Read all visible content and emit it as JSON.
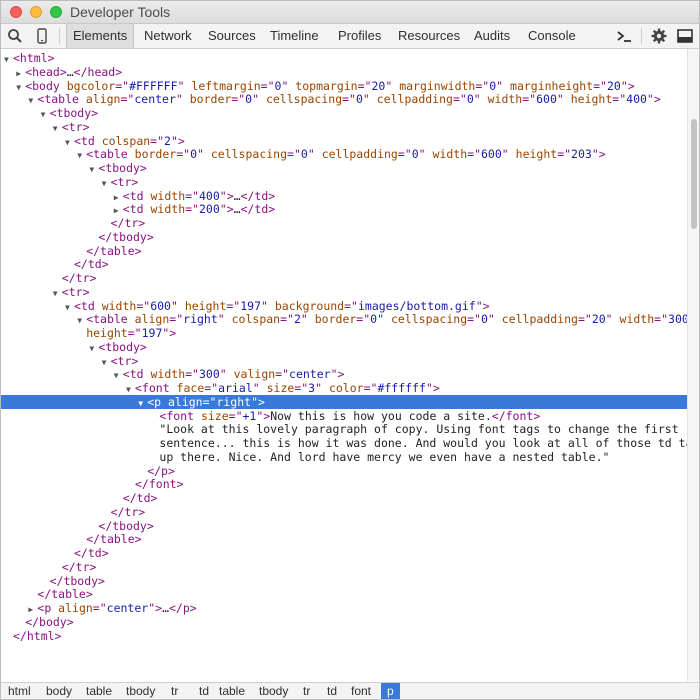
{
  "window": {
    "title": "Developer Tools"
  },
  "toolbar": {
    "left_icons": [
      "search-icon",
      "device-icon"
    ],
    "tabs": [
      {
        "label": "Elements",
        "active": true
      },
      {
        "label": "Network"
      },
      {
        "label": "Sources"
      },
      {
        "label": "Timeline"
      },
      {
        "label": "Profiles"
      },
      {
        "label": "Resources"
      },
      {
        "label": "Audits"
      },
      {
        "label": "Console"
      }
    ],
    "right_icons": [
      "console-drawer-icon",
      "gear-icon",
      "dock-icon"
    ]
  },
  "dom_tree": [
    {
      "indent": 0,
      "arrow": "down",
      "tokens": [
        [
          "tag",
          "<html>"
        ]
      ]
    },
    {
      "indent": 1,
      "arrow": "right",
      "tokens": [
        [
          "tag",
          "<head>"
        ],
        [
          "txt",
          "…"
        ],
        [
          "tag",
          "</head>"
        ]
      ]
    },
    {
      "indent": 1,
      "arrow": "down",
      "tokens": [
        [
          "tag",
          "<body "
        ],
        [
          "an",
          "bgcolor"
        ],
        [
          "tag",
          "=\""
        ],
        [
          "av",
          "#FFFFFF"
        ],
        [
          "tag",
          "\" "
        ],
        [
          "an",
          "leftmargin"
        ],
        [
          "tag",
          "=\""
        ],
        [
          "av",
          "0"
        ],
        [
          "tag",
          "\" "
        ],
        [
          "an",
          "topmargin"
        ],
        [
          "tag",
          "=\""
        ],
        [
          "av",
          "20"
        ],
        [
          "tag",
          "\" "
        ],
        [
          "an",
          "marginwidth"
        ],
        [
          "tag",
          "=\""
        ],
        [
          "av",
          "0"
        ],
        [
          "tag",
          "\" "
        ],
        [
          "an",
          "marginheight"
        ],
        [
          "tag",
          "=\""
        ],
        [
          "av",
          "20"
        ],
        [
          "tag",
          "\">"
        ]
      ]
    },
    {
      "indent": 2,
      "arrow": "down",
      "tokens": [
        [
          "tag",
          "<table "
        ],
        [
          "an",
          "align"
        ],
        [
          "tag",
          "=\""
        ],
        [
          "av",
          "center"
        ],
        [
          "tag",
          "\" "
        ],
        [
          "an",
          "border"
        ],
        [
          "tag",
          "=\""
        ],
        [
          "av",
          "0"
        ],
        [
          "tag",
          "\" "
        ],
        [
          "an",
          "cellspacing"
        ],
        [
          "tag",
          "=\""
        ],
        [
          "av",
          "0"
        ],
        [
          "tag",
          "\" "
        ],
        [
          "an",
          "cellpadding"
        ],
        [
          "tag",
          "=\""
        ],
        [
          "av",
          "0"
        ],
        [
          "tag",
          "\" "
        ],
        [
          "an",
          "width"
        ],
        [
          "tag",
          "=\""
        ],
        [
          "av",
          "600"
        ],
        [
          "tag",
          "\" "
        ],
        [
          "an",
          "height"
        ],
        [
          "tag",
          "=\""
        ],
        [
          "av",
          "400"
        ],
        [
          "tag",
          "\">"
        ]
      ]
    },
    {
      "indent": 3,
      "arrow": "down",
      "tokens": [
        [
          "tag",
          "<tbody>"
        ]
      ]
    },
    {
      "indent": 4,
      "arrow": "down",
      "tokens": [
        [
          "tag",
          "<tr>"
        ]
      ]
    },
    {
      "indent": 5,
      "arrow": "down",
      "tokens": [
        [
          "tag",
          "<td "
        ],
        [
          "an",
          "colspan"
        ],
        [
          "tag",
          "=\""
        ],
        [
          "av",
          "2"
        ],
        [
          "tag",
          "\">"
        ]
      ]
    },
    {
      "indent": 6,
      "arrow": "down",
      "tokens": [
        [
          "tag",
          "<table "
        ],
        [
          "an",
          "border"
        ],
        [
          "tag",
          "=\""
        ],
        [
          "av",
          "0"
        ],
        [
          "tag",
          "\" "
        ],
        [
          "an",
          "cellspacing"
        ],
        [
          "tag",
          "=\""
        ],
        [
          "av",
          "0"
        ],
        [
          "tag",
          "\" "
        ],
        [
          "an",
          "cellpadding"
        ],
        [
          "tag",
          "=\""
        ],
        [
          "av",
          "0"
        ],
        [
          "tag",
          "\" "
        ],
        [
          "an",
          "width"
        ],
        [
          "tag",
          "=\""
        ],
        [
          "av",
          "600"
        ],
        [
          "tag",
          "\" "
        ],
        [
          "an",
          "height"
        ],
        [
          "tag",
          "=\""
        ],
        [
          "av",
          "203"
        ],
        [
          "tag",
          "\">"
        ]
      ]
    },
    {
      "indent": 7,
      "arrow": "down",
      "tokens": [
        [
          "tag",
          "<tbody>"
        ]
      ]
    },
    {
      "indent": 8,
      "arrow": "down",
      "tokens": [
        [
          "tag",
          "<tr>"
        ]
      ]
    },
    {
      "indent": 9,
      "arrow": "right",
      "tokens": [
        [
          "tag",
          "<td "
        ],
        [
          "an",
          "width"
        ],
        [
          "tag",
          "=\""
        ],
        [
          "av",
          "400"
        ],
        [
          "tag",
          "\">"
        ],
        [
          "txt",
          "…"
        ],
        [
          "tag",
          "</td>"
        ]
      ]
    },
    {
      "indent": 9,
      "arrow": "right",
      "tokens": [
        [
          "tag",
          "<td "
        ],
        [
          "an",
          "width"
        ],
        [
          "tag",
          "=\""
        ],
        [
          "av",
          "200"
        ],
        [
          "tag",
          "\">"
        ],
        [
          "txt",
          "…"
        ],
        [
          "tag",
          "</td>"
        ]
      ]
    },
    {
      "indent": 8,
      "arrow": "",
      "tokens": [
        [
          "tag",
          "</tr>"
        ]
      ]
    },
    {
      "indent": 7,
      "arrow": "",
      "tokens": [
        [
          "tag",
          "</tbody>"
        ]
      ]
    },
    {
      "indent": 6,
      "arrow": "",
      "tokens": [
        [
          "tag",
          "</table>"
        ]
      ]
    },
    {
      "indent": 5,
      "arrow": "",
      "tokens": [
        [
          "tag",
          "</td>"
        ]
      ]
    },
    {
      "indent": 4,
      "arrow": "",
      "tokens": [
        [
          "tag",
          "</tr>"
        ]
      ]
    },
    {
      "indent": 4,
      "arrow": "down",
      "tokens": [
        [
          "tag",
          "<tr>"
        ]
      ]
    },
    {
      "indent": 5,
      "arrow": "down",
      "tokens": [
        [
          "tag",
          "<td "
        ],
        [
          "an",
          "width"
        ],
        [
          "tag",
          "=\""
        ],
        [
          "av",
          "600"
        ],
        [
          "tag",
          "\" "
        ],
        [
          "an",
          "height"
        ],
        [
          "tag",
          "=\""
        ],
        [
          "av",
          "197"
        ],
        [
          "tag",
          "\" "
        ],
        [
          "an",
          "background"
        ],
        [
          "tag",
          "=\""
        ],
        [
          "av",
          "images/bottom.gif"
        ],
        [
          "tag",
          "\">"
        ]
      ]
    },
    {
      "indent": 6,
      "arrow": "down",
      "tokens": [
        [
          "tag",
          "<table "
        ],
        [
          "an",
          "align"
        ],
        [
          "tag",
          "=\""
        ],
        [
          "av",
          "right"
        ],
        [
          "tag",
          "\" "
        ],
        [
          "an",
          "colspan"
        ],
        [
          "tag",
          "=\""
        ],
        [
          "av",
          "2"
        ],
        [
          "tag",
          "\" "
        ],
        [
          "an",
          "border"
        ],
        [
          "tag",
          "=\""
        ],
        [
          "av",
          "0"
        ],
        [
          "tag",
          "\" "
        ],
        [
          "an",
          "cellspacing"
        ],
        [
          "tag",
          "=\""
        ],
        [
          "av",
          "0"
        ],
        [
          "tag",
          "\" "
        ],
        [
          "an",
          "cellpadding"
        ],
        [
          "tag",
          "=\""
        ],
        [
          "av",
          "20"
        ],
        [
          "tag",
          "\" "
        ],
        [
          "an",
          "width"
        ],
        [
          "tag",
          "=\""
        ],
        [
          "av",
          "300"
        ],
        [
          "tag",
          "\""
        ]
      ]
    },
    {
      "indent": 6,
      "arrow": "",
      "tokens": [
        [
          "an",
          "height"
        ],
        [
          "tag",
          "=\""
        ],
        [
          "av",
          "197"
        ],
        [
          "tag",
          "\">"
        ]
      ]
    },
    {
      "indent": 7,
      "arrow": "down",
      "tokens": [
        [
          "tag",
          "<tbody>"
        ]
      ]
    },
    {
      "indent": 8,
      "arrow": "down",
      "tokens": [
        [
          "tag",
          "<tr>"
        ]
      ]
    },
    {
      "indent": 9,
      "arrow": "down",
      "tokens": [
        [
          "tag",
          "<td "
        ],
        [
          "an",
          "width"
        ],
        [
          "tag",
          "=\""
        ],
        [
          "av",
          "300"
        ],
        [
          "tag",
          "\" "
        ],
        [
          "an",
          "valign"
        ],
        [
          "tag",
          "=\""
        ],
        [
          "av",
          "center"
        ],
        [
          "tag",
          "\">"
        ]
      ]
    },
    {
      "indent": 10,
      "arrow": "down",
      "tokens": [
        [
          "tag",
          "<font "
        ],
        [
          "an",
          "face"
        ],
        [
          "tag",
          "=\""
        ],
        [
          "av",
          "arial"
        ],
        [
          "tag",
          "\" "
        ],
        [
          "an",
          "size"
        ],
        [
          "tag",
          "=\""
        ],
        [
          "av",
          "3"
        ],
        [
          "tag",
          "\" "
        ],
        [
          "an",
          "color"
        ],
        [
          "tag",
          "=\""
        ],
        [
          "av",
          "#ffffff"
        ],
        [
          "tag",
          "\">"
        ]
      ]
    },
    {
      "indent": 11,
      "arrow": "down",
      "selected": true,
      "tokens": [
        [
          "tag",
          "<p "
        ],
        [
          "an",
          "align"
        ],
        [
          "tag",
          "=\""
        ],
        [
          "av",
          "right"
        ],
        [
          "tag",
          "\">"
        ]
      ]
    },
    {
      "indent": 12,
      "arrow": "",
      "tokens": [
        [
          "tag",
          "<font "
        ],
        [
          "an",
          "size"
        ],
        [
          "tag",
          "=\""
        ],
        [
          "av",
          "+1"
        ],
        [
          "tag",
          "\">"
        ],
        [
          "txt",
          "Now this is how you code a site."
        ],
        [
          "tag",
          "</font>"
        ]
      ]
    },
    {
      "indent": 12,
      "arrow": "",
      "tokens": [
        [
          "txt",
          "\"Look at this lovely paragraph of copy. Using font tags to change the first"
        ]
      ]
    },
    {
      "indent": 12,
      "arrow": "",
      "tokens": [
        [
          "txt",
          "sentence... this is how it was done. And would you look at all of those td tags"
        ]
      ]
    },
    {
      "indent": 12,
      "arrow": "",
      "tokens": [
        [
          "txt",
          "up there. Nice. And lord have mercy we even have a nested table.\""
        ]
      ]
    },
    {
      "indent": 11,
      "arrow": "",
      "tokens": [
        [
          "tag",
          "</p>"
        ]
      ]
    },
    {
      "indent": 10,
      "arrow": "",
      "tokens": [
        [
          "tag",
          "</font>"
        ]
      ]
    },
    {
      "indent": 9,
      "arrow": "",
      "tokens": [
        [
          "tag",
          "</td>"
        ]
      ]
    },
    {
      "indent": 8,
      "arrow": "",
      "tokens": [
        [
          "tag",
          "</tr>"
        ]
      ]
    },
    {
      "indent": 7,
      "arrow": "",
      "tokens": [
        [
          "tag",
          "</tbody>"
        ]
      ]
    },
    {
      "indent": 6,
      "arrow": "",
      "tokens": [
        [
          "tag",
          "</table>"
        ]
      ]
    },
    {
      "indent": 5,
      "arrow": "",
      "tokens": [
        [
          "tag",
          "</td>"
        ]
      ]
    },
    {
      "indent": 4,
      "arrow": "",
      "tokens": [
        [
          "tag",
          "</tr>"
        ]
      ]
    },
    {
      "indent": 3,
      "arrow": "",
      "tokens": [
        [
          "tag",
          "</tbody>"
        ]
      ]
    },
    {
      "indent": 2,
      "arrow": "",
      "tokens": [
        [
          "tag",
          "</table>"
        ]
      ]
    },
    {
      "indent": 2,
      "arrow": "right",
      "tokens": [
        [
          "tag",
          "<p "
        ],
        [
          "an",
          "align"
        ],
        [
          "tag",
          "=\""
        ],
        [
          "av",
          "center"
        ],
        [
          "tag",
          "\">"
        ],
        [
          "txt",
          "…"
        ],
        [
          "tag",
          "</p>"
        ]
      ]
    },
    {
      "indent": 1,
      "arrow": "",
      "tokens": [
        [
          "tag",
          "</body>"
        ]
      ]
    },
    {
      "indent": 0,
      "arrow": "",
      "tokens": [
        [
          "tag",
          "</html>"
        ]
      ]
    }
  ],
  "breadcrumbs": [
    {
      "label": "html"
    },
    {
      "label": "body"
    },
    {
      "label": "table"
    },
    {
      "label": "tbody"
    },
    {
      "label": "tr"
    },
    {
      "label": "td"
    },
    {
      "label": "table"
    },
    {
      "label": "tbody"
    },
    {
      "label": "tr"
    },
    {
      "label": "td"
    },
    {
      "label": "font"
    },
    {
      "label": "p",
      "active": true
    }
  ],
  "colors": {
    "selection": "#3879d9",
    "tag": "#881280",
    "attr_name": "#994500",
    "attr_value": "#1a1aa6"
  }
}
